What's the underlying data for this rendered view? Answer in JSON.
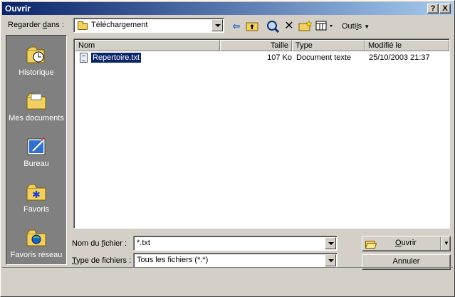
{
  "window": {
    "title": "Ouvrir",
    "help_button": "?",
    "close_button": "X"
  },
  "toolbar": {
    "look_in_label_pre": "Regarder ",
    "look_in_label_key": "d",
    "look_in_label_post": "ans :",
    "look_in_value": "Téléchargement",
    "tools_label_pre": "Outi",
    "tools_label_key": "l",
    "tools_label_post": "s",
    "icons": [
      "back-icon",
      "up-folder-icon",
      "search-web-icon",
      "delete-icon",
      "new-folder-icon",
      "views-icon"
    ]
  },
  "places": [
    {
      "label": "Historique",
      "icon": "history-icon"
    },
    {
      "label": "Mes documents",
      "icon": "my-documents-icon"
    },
    {
      "label": "Bureau",
      "icon": "desktop-icon"
    },
    {
      "label": "Favoris",
      "icon": "favorites-icon"
    },
    {
      "label": "Favoris réseau",
      "icon": "network-favorites-icon"
    }
  ],
  "filelist": {
    "columns": [
      "Nom",
      "Taille",
      "Type",
      "Modifié le"
    ],
    "rows": [
      {
        "name": "Repertoire.txt",
        "size": "107 Ko",
        "type": "Document texte",
        "modified": "25/10/2003 21:37"
      }
    ]
  },
  "filename": {
    "label_pre": "Nom du ",
    "label_key": "f",
    "label_post": "ichier :",
    "value": "*.txt"
  },
  "filetype": {
    "label_key": "T",
    "label_post": "ype de fichiers :",
    "value": "Tous les fichiers (*.*)"
  },
  "buttons": {
    "open_key": "O",
    "open_post": "uvrir",
    "cancel": "Annuler"
  },
  "colors": {
    "titlebar_start": "#0a246a",
    "titlebar_end": "#a6caf0",
    "face": "#d4d0c8",
    "selection": "#0a246a",
    "places_bg": "#808080"
  }
}
